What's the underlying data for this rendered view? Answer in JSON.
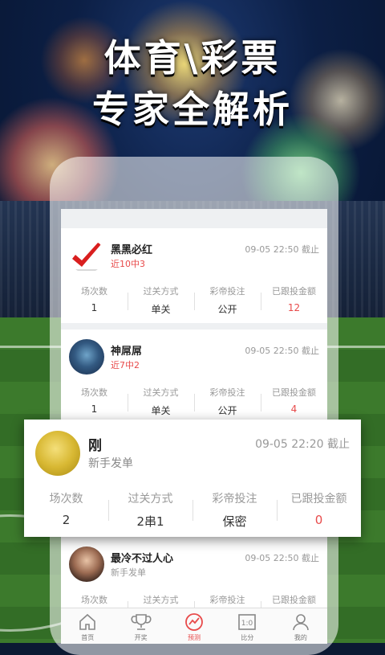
{
  "headline": {
    "line1": "体育\\彩票",
    "line2": "专家全解析"
  },
  "stat_labels": {
    "matches": "场次数",
    "pass_type": "过关方式",
    "investment": "彩帝投注",
    "followed": "已跟投金额"
  },
  "cards": [
    {
      "name": "黑黑必红",
      "record": "近10中3",
      "time": "09-05 22:50 截止",
      "matches": "1",
      "pass_type": "单关",
      "investment": "公开",
      "followed": "12"
    },
    {
      "name": "神屌屌",
      "record": "近7中2",
      "time": "09-05 22:50 截止",
      "matches": "1",
      "pass_type": "单关",
      "investment": "公开",
      "followed": "4"
    },
    {
      "name": "最冷不过人心",
      "record": "新手发单",
      "time": "09-05 22:50 截止"
    }
  ],
  "highlight": {
    "name": "刚",
    "record": "新手发单",
    "time": "09-05 22:20 截止",
    "matches": "2",
    "pass_type": "2串1",
    "investment": "保密",
    "followed": "0"
  },
  "tabbar": [
    {
      "label": "首页",
      "icon": "home-icon"
    },
    {
      "label": "开奖",
      "icon": "trophy-icon"
    },
    {
      "label": "预测",
      "icon": "chart-circle-icon",
      "active": true
    },
    {
      "label": "比分",
      "icon": "scoreboard-icon"
    },
    {
      "label": "我的",
      "icon": "user-icon"
    }
  ],
  "colors": {
    "accent": "#e84b4b",
    "muted": "#999999"
  }
}
